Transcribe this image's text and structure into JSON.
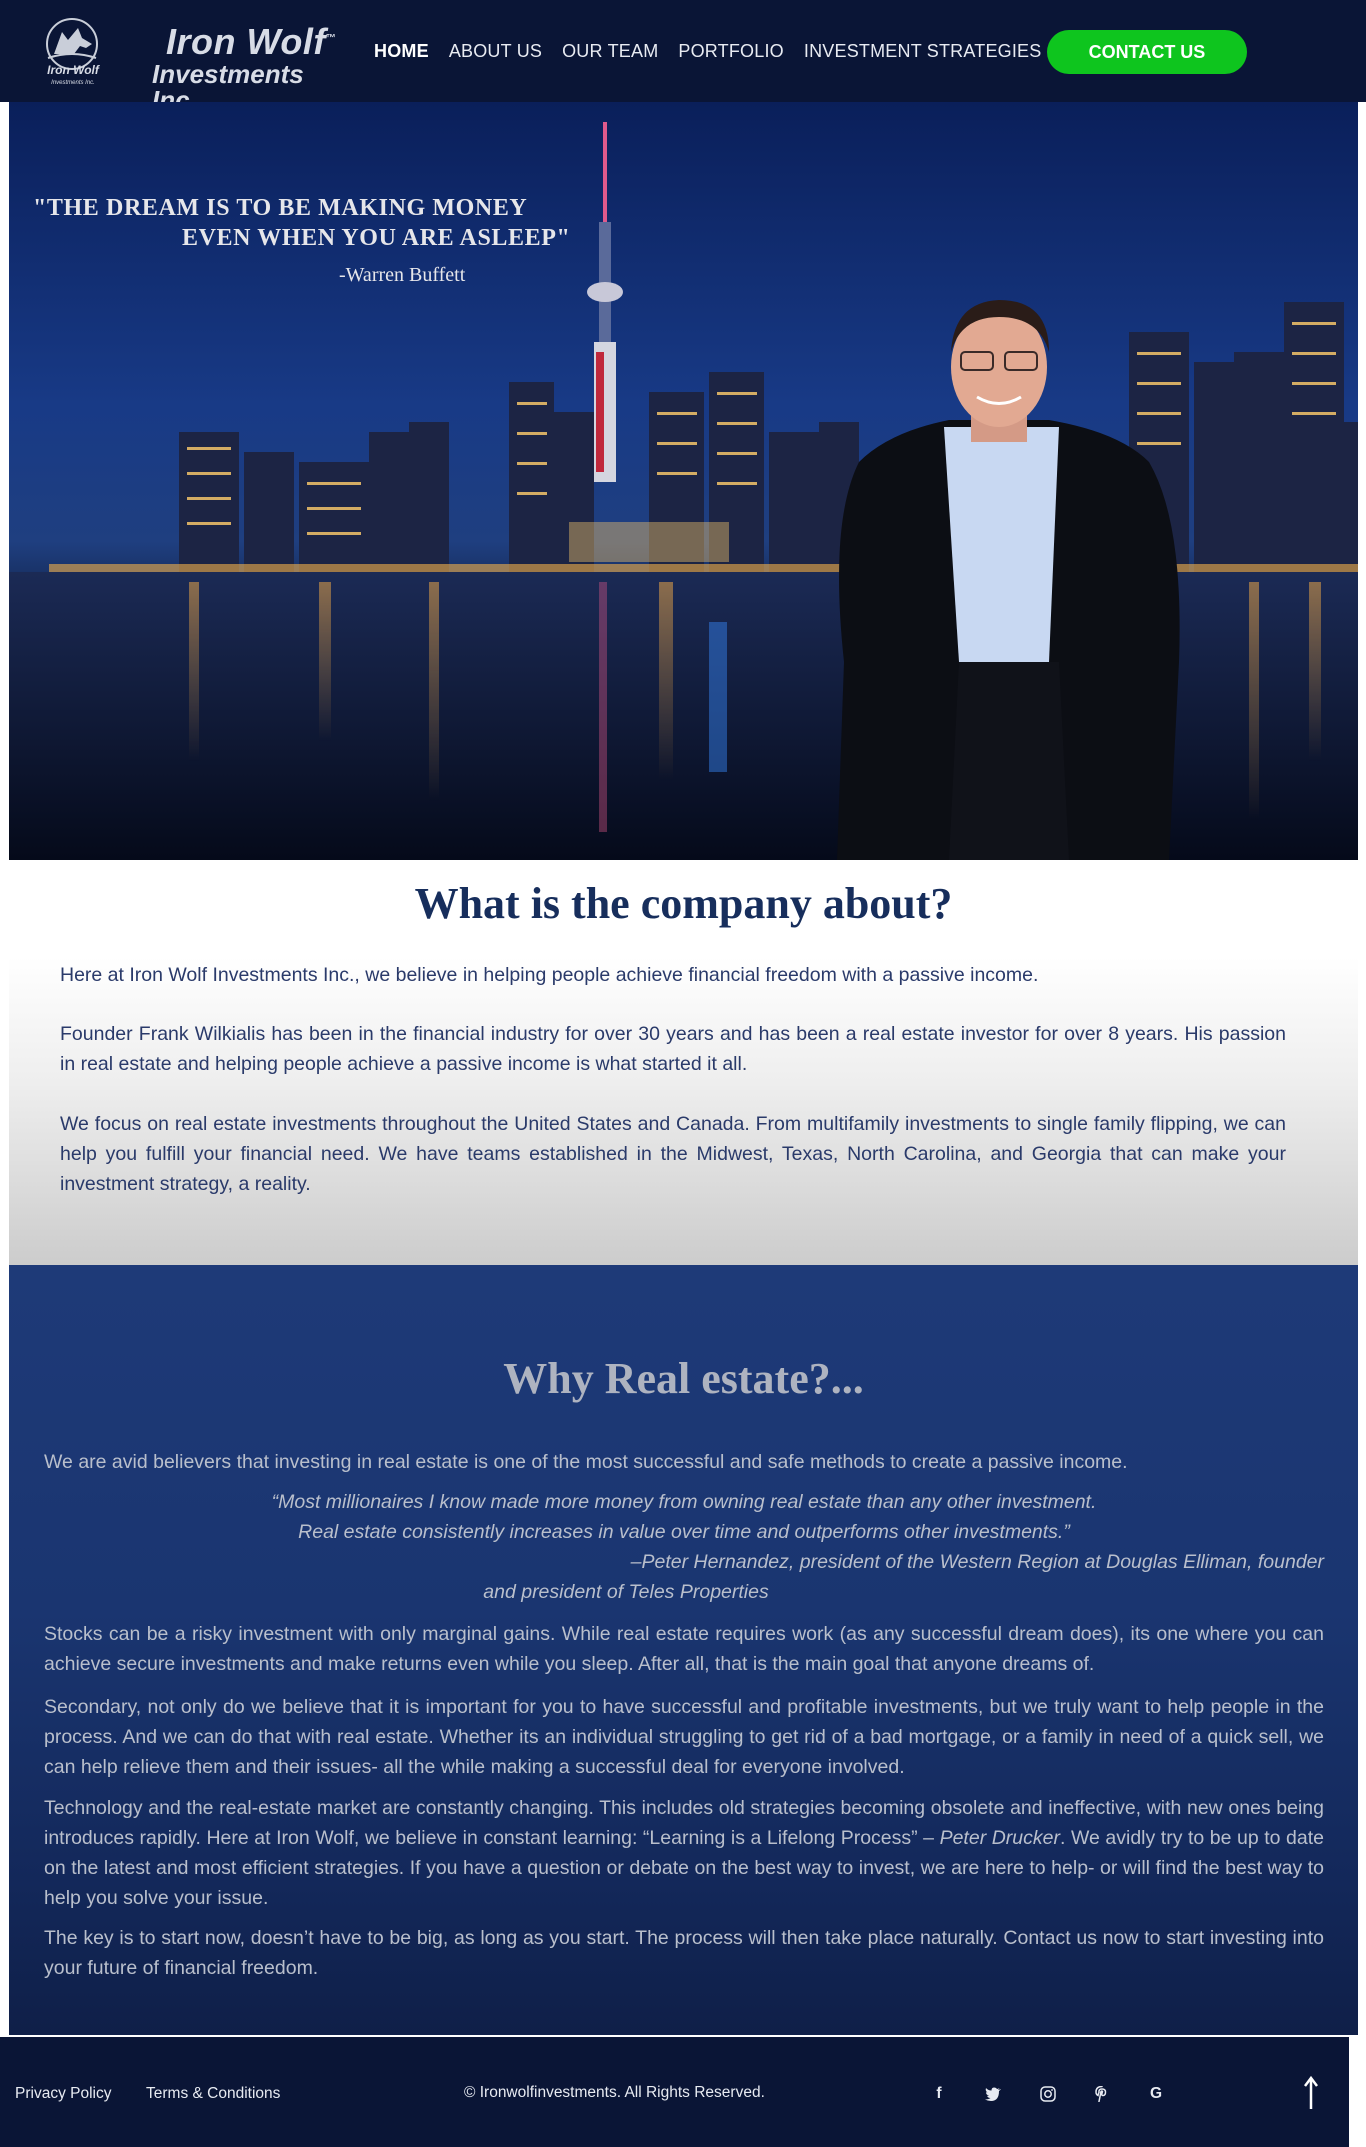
{
  "header": {
    "logo_emblem_text": "Iron Wolf",
    "logo_emblem_sub": "Investments Inc.",
    "logo_name": "Iron Wolf",
    "logo_tm": "™",
    "logo_sub": "Investments Inc.",
    "nav": {
      "home": "HOME",
      "about": "ABOUT US",
      "team": "OUR TEAM",
      "portfolio": "PORTFOLIO",
      "strategies": "INVESTMENT STRATEGIES"
    },
    "contact_label": "CONTACT US"
  },
  "hero": {
    "quote_line1": "\"THE DREAM IS TO BE MAKING MONEY",
    "quote_line2": "EVEN WHEN YOU ARE ASLEEP\"",
    "quote_author": "-Warren Buffett"
  },
  "about": {
    "title": "What is the company about?",
    "p1": "Here at Iron Wolf Investments Inc., we believe in helping people achieve financial freedom with a passive income.",
    "p2": "Founder Frank Wilkialis has been in the financial industry for over 30 years and has been a real estate investor for over 8 years. His passion in real estate and helping people achieve a passive income is what started it all.",
    "p3": "We focus on real estate investments throughout the United States and Canada. From multifamily investments to single family flipping, we can help you fulfill your financial need. We have teams established in the Midwest, Texas, North Carolina, and Georgia that can make your investment strategy, a reality."
  },
  "why": {
    "title": "Why Real estate?...",
    "intro": "We are avid believers that investing in real estate is one of the most successful and safe methods to create a passive income.",
    "quote1": "“Most millionaires I know made more money from owning real estate than any other investment.",
    "quote2": "Real estate consistently increases in value over time and outperforms other investments.”",
    "quote3": "–Peter Hernandez, president of the Western Region at Douglas Elliman, founder",
    "quote4": "and president of Teles Properties",
    "p1": "Stocks can be a risky investment with only marginal gains. While real estate requires work (as any successful dream does), its one where you can achieve secure investments and make returns even while you sleep. After all, that is the main goal that anyone dreams of.",
    "p2": "Secondary, not only do we believe that it is important for you to have successful and profitable investments, but we truly want to help people in the process. And we can do that with real estate. Whether its an individual struggling to get rid of a bad mortgage, or a family in need of a quick sell, we can help relieve them and their issues- all the while making a successful deal for everyone involved.",
    "p3_a": "Technology and the real-estate market are constantly changing. This includes old strategies becoming obsolete and ineffective, with new ones being introduces rapidly. Here at Iron Wolf, we believe in constant learning: “Learning is a Lifelong Process” – ",
    "p3_author": "Peter Drucker",
    "p3_b": ". We avidly try to be up to date on the latest and most efficient strategies. If you have a question or debate on the best way to invest, we are here to help- or will find the best way to help you solve your issue.",
    "p4": "The key is to start now, doesn’t have to be big, as long as you start. The process will then take place naturally. Contact us now to start investing into your future of financial freedom."
  },
  "footer": {
    "privacy": "Privacy Policy",
    "terms": "Terms & Conditions",
    "copyright": "© Ironwolfinvestments. All Rights Reserved.",
    "social": {
      "facebook": "f",
      "twitter": "🐦",
      "instagram": "◎",
      "pinterest": "℗",
      "google": "G"
    }
  },
  "colors": {
    "header_bg": "#0a1536",
    "accent_green": "#0ec51e",
    "title_navy": "#172e5c",
    "why_bg": "#1a3570"
  }
}
